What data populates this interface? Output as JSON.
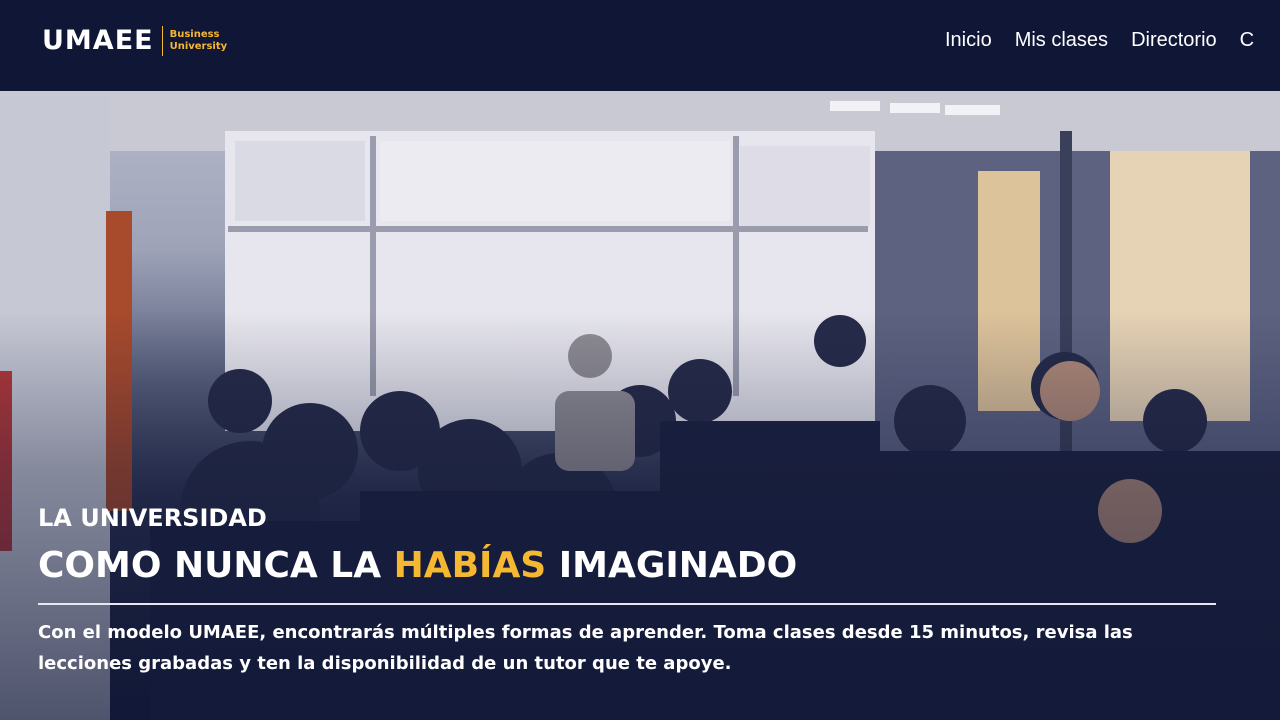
{
  "header": {
    "logo_text": "UMAEE",
    "logo_sub_line1": "Business",
    "logo_sub_line2": "University",
    "nav": [
      {
        "label": "Inicio"
      },
      {
        "label": "Mis clases"
      },
      {
        "label": "Directorio"
      },
      {
        "label": "C"
      }
    ]
  },
  "hero": {
    "kicker": "LA UNIVERSIDAD",
    "title_part1": "COMO NUNCA LA ",
    "title_accent": "HABÍAS",
    "title_part2": " IMAGINADO",
    "description": "Con el modelo UMAEE, encontrarás múltiples formas de aprender. Toma clases desde 15 minutos, revisa las lecciones grabadas y ten la disponibilidad de un tutor que te apoye."
  },
  "colors": {
    "navbar": "#0f1636",
    "accent": "#f6b830",
    "text": "#ffffff"
  }
}
